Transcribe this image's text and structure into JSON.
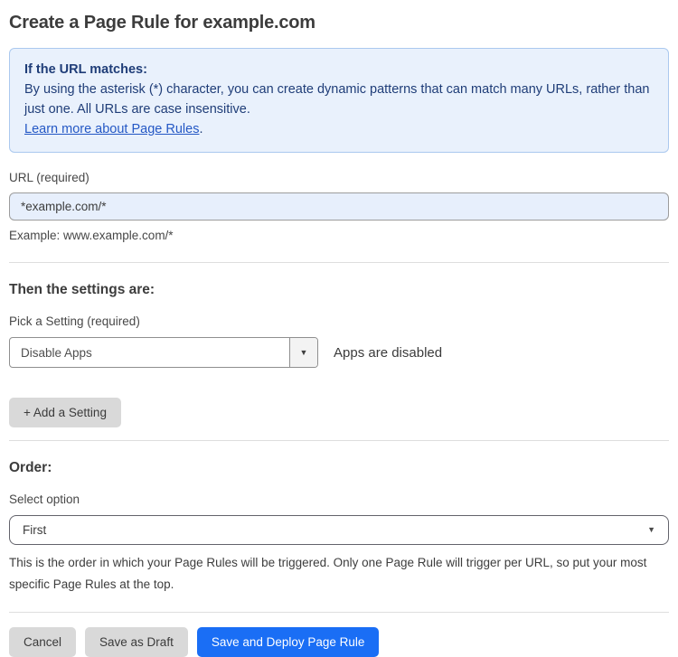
{
  "page": {
    "title": "Create a Page Rule for example.com"
  },
  "info_box": {
    "heading": "If the URL matches:",
    "body": "By using the asterisk (*) character, you can create dynamic patterns that can match many URLs, rather than just one. All URLs are case insensitive.",
    "link_label": "Learn more about Page Rules",
    "link_suffix": "."
  },
  "url_field": {
    "label": "URL (required)",
    "value": "*example.com/*",
    "example": "Example: www.example.com/*"
  },
  "settings_section": {
    "heading": "Then the settings are:",
    "pick_label": "Pick a Setting (required)",
    "selected_setting": "Disable Apps",
    "dropdown_caret": "▼",
    "status_text": "Apps are disabled",
    "add_button_label": "+ Add a Setting"
  },
  "order_section": {
    "heading": "Order:",
    "select_label": "Select option",
    "selected_option": "First",
    "select_caret": "▼",
    "help_text": "This is the order in which your Page Rules will be triggered. Only one Page Rule will trigger per URL, so put your most specific Page Rules at the top."
  },
  "footer": {
    "cancel_label": "Cancel",
    "save_draft_label": "Save as Draft",
    "save_deploy_label": "Save and Deploy Page Rule"
  },
  "colors": {
    "accent": "#1a6ef5",
    "info_bg": "#e9f1fc",
    "info_border": "#abc9ef",
    "info_text": "#1f3d78",
    "link": "#2458c5",
    "input_bg": "#e7effc"
  }
}
